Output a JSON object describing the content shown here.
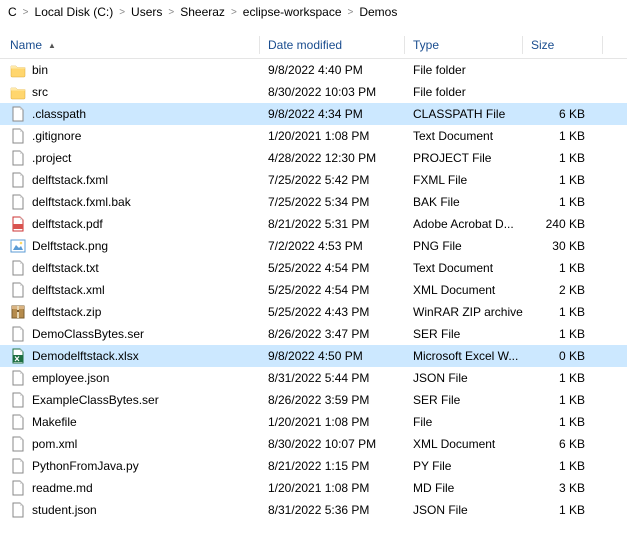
{
  "breadcrumb": [
    "C",
    "Local Disk (C:)",
    "Users",
    "Sheeraz",
    "eclipse-workspace",
    "Demos"
  ],
  "headers": {
    "name": "Name",
    "modified": "Date modified",
    "type": "Type",
    "size": "Size"
  },
  "files": [
    {
      "icon": "folder",
      "name": "bin",
      "modified": "9/8/2022 4:40 PM",
      "type": "File folder",
      "size": "",
      "selected": false
    },
    {
      "icon": "folder",
      "name": "src",
      "modified": "8/30/2022 10:03 PM",
      "type": "File folder",
      "size": "",
      "selected": false
    },
    {
      "icon": "file",
      "name": ".classpath",
      "modified": "9/8/2022 4:34 PM",
      "type": "CLASSPATH File",
      "size": "6 KB",
      "selected": true
    },
    {
      "icon": "file",
      "name": ".gitignore",
      "modified": "1/20/2021 1:08 PM",
      "type": "Text Document",
      "size": "1 KB",
      "selected": false
    },
    {
      "icon": "file",
      "name": ".project",
      "modified": "4/28/2022 12:30 PM",
      "type": "PROJECT File",
      "size": "1 KB",
      "selected": false
    },
    {
      "icon": "file",
      "name": "delftstack.fxml",
      "modified": "7/25/2022 5:42 PM",
      "type": "FXML File",
      "size": "1 KB",
      "selected": false
    },
    {
      "icon": "file",
      "name": "delftstack.fxml.bak",
      "modified": "7/25/2022 5:34 PM",
      "type": "BAK File",
      "size": "1 KB",
      "selected": false
    },
    {
      "icon": "pdf",
      "name": "delftstack.pdf",
      "modified": "8/21/2022 5:31 PM",
      "type": "Adobe Acrobat D...",
      "size": "240 KB",
      "selected": false
    },
    {
      "icon": "png",
      "name": "Delftstack.png",
      "modified": "7/2/2022 4:53 PM",
      "type": "PNG File",
      "size": "30 KB",
      "selected": false
    },
    {
      "icon": "file",
      "name": "delftstack.txt",
      "modified": "5/25/2022 4:54 PM",
      "type": "Text Document",
      "size": "1 KB",
      "selected": false
    },
    {
      "icon": "file",
      "name": "delftstack.xml",
      "modified": "5/25/2022 4:54 PM",
      "type": "XML Document",
      "size": "2 KB",
      "selected": false
    },
    {
      "icon": "zip",
      "name": "delftstack.zip",
      "modified": "5/25/2022 4:43 PM",
      "type": "WinRAR ZIP archive",
      "size": "1 KB",
      "selected": false
    },
    {
      "icon": "file",
      "name": "DemoClassBytes.ser",
      "modified": "8/26/2022 3:47 PM",
      "type": "SER File",
      "size": "1 KB",
      "selected": false
    },
    {
      "icon": "xlsx",
      "name": "Demodelftstack.xlsx",
      "modified": "9/8/2022 4:50 PM",
      "type": "Microsoft Excel W...",
      "size": "0 KB",
      "selected": true
    },
    {
      "icon": "file",
      "name": "employee.json",
      "modified": "8/31/2022 5:44 PM",
      "type": "JSON File",
      "size": "1 KB",
      "selected": false
    },
    {
      "icon": "file",
      "name": "ExampleClassBytes.ser",
      "modified": "8/26/2022 3:59 PM",
      "type": "SER File",
      "size": "1 KB",
      "selected": false
    },
    {
      "icon": "file",
      "name": "Makefile",
      "modified": "1/20/2021 1:08 PM",
      "type": "File",
      "size": "1 KB",
      "selected": false
    },
    {
      "icon": "file",
      "name": "pom.xml",
      "modified": "8/30/2022 10:07 PM",
      "type": "XML Document",
      "size": "6 KB",
      "selected": false
    },
    {
      "icon": "file",
      "name": "PythonFromJava.py",
      "modified": "8/21/2022 1:15 PM",
      "type": "PY File",
      "size": "1 KB",
      "selected": false
    },
    {
      "icon": "file",
      "name": "readme.md",
      "modified": "1/20/2021 1:08 PM",
      "type": "MD File",
      "size": "3 KB",
      "selected": false
    },
    {
      "icon": "file",
      "name": "student.json",
      "modified": "8/31/2022 5:36 PM",
      "type": "JSON File",
      "size": "1 KB",
      "selected": false
    }
  ]
}
